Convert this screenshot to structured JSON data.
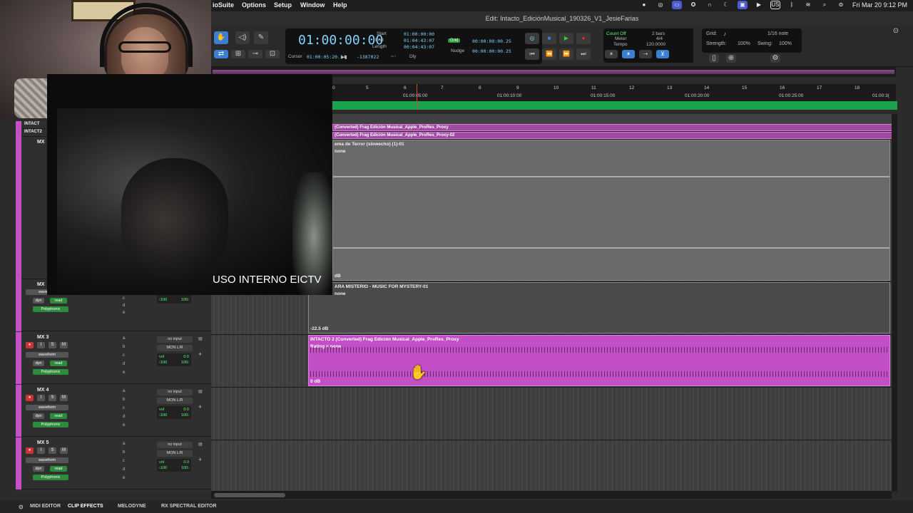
{
  "menubar": {
    "app_name": "ioSuite",
    "menus": [
      "Options",
      "Setup",
      "Window",
      "Help"
    ],
    "clock": "Fri Mar 20  9:12 PM",
    "input_source": "US"
  },
  "window": {
    "title": "Edit: Intacto_EdiciónMusical_190326_V1_JesieFarias"
  },
  "toolbar": {
    "main_counter": "01:00:00:00",
    "start_label": "Start",
    "end_label": "End",
    "length_label": "Length",
    "start_value": "01:00:00:00",
    "end_value": "01:04:43:07",
    "length_value": "00:04:43:07",
    "cursor_label": "Cursor",
    "cursor_value": "01:00:05:20.14",
    "cursor_sample": "-1387022",
    "dly_label": "Dly",
    "grid_badge": "Grid",
    "grid_value": "00:00:00:00.25",
    "nudge_label": "Nudge",
    "nudge_value": "00:00:00:00.25",
    "count_off": "Count Off",
    "meter_label": "Meter",
    "tempo_label": "Tempo",
    "count_bars": "2 bars",
    "meter_value": "4/4",
    "tempo_value": "120.0000",
    "grid_label": "Grid:",
    "grid_note": "1/16 note",
    "strength_label": "Strength:",
    "strength_value": "100%",
    "swing_label": "Swing:",
    "swing_value": "100%"
  },
  "ruler": {
    "bars": [
      "5",
      "6",
      "7",
      "8",
      "9",
      "10",
      "11",
      "12",
      "13",
      "14",
      "15",
      "16",
      "17",
      "18"
    ],
    "timecodes": [
      "01:00:05:00",
      "01:00:10:00",
      "01:00:15:00",
      "01:00:20:00",
      "01:00:25:00",
      "01:00:3("
    ],
    "first_bar_partial": "0"
  },
  "tracks": [
    {
      "name": "INTACT",
      "clip": "(Converted) Frag Edición Musical_Apple_ProRes_Proxy"
    },
    {
      "name": "INTACT2",
      "clip": "(Converted) Frag Edición Musical_Apple_ProRes_Proxy-02"
    },
    {
      "name": "MX",
      "clip": "ema de Terror (slowecho) (1)-01",
      "rating": "none",
      "gain": "dB"
    },
    {
      "name": "MX",
      "clip": "ARA MISTERIO - MUSIC FOR MYSTERY-01",
      "rating": "none",
      "gain": "-22.5 dB"
    },
    {
      "name": "MX 3",
      "clip": "INTACTO 2 (Converted) Frag Edición Musical_Apple_ProRes_Proxy",
      "rating": "Rating = none",
      "gain": "0 dB"
    },
    {
      "name": "MX 4"
    },
    {
      "name": "MX 5"
    }
  ],
  "track_controls": {
    "input": "no input",
    "output": "MON L/R",
    "view": "waveform",
    "dyn": "dyn",
    "read": "read",
    "poly": "Polyphonic",
    "vol_label": "vol",
    "vol_value": "0.0",
    "pan_left": "‹100",
    "pan_right": "100›",
    "btn_i": "I",
    "btn_s": "S",
    "btn_m": "M",
    "inserts": [
      "a",
      "b",
      "c",
      "d",
      "e"
    ]
  },
  "video": {
    "caption": "USO INTERNO EICTV"
  },
  "bottom_tabs": [
    "MIDI EDITOR",
    "CLIP EFFECTS",
    "MELODYNE",
    "RX SPECTRAL EDITOR"
  ],
  "colors": {
    "track_color": "#c24fc6",
    "counter_color": "#7fd2ff",
    "marker_green": "#1aa34a",
    "record_red": "#e03030"
  }
}
